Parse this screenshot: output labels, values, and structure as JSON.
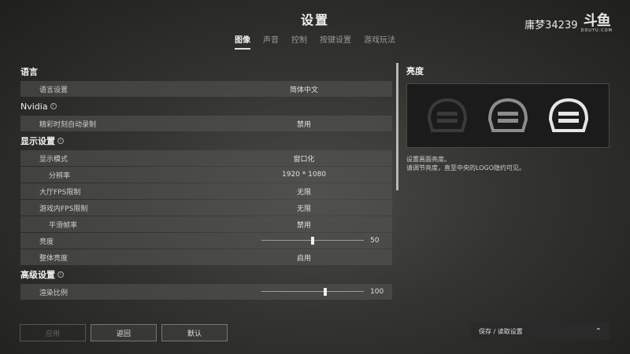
{
  "header": {
    "title": "设置",
    "tabs": [
      "图像",
      "声音",
      "控制",
      "按键设置",
      "游戏玩法"
    ],
    "active_tab": "图像"
  },
  "watermark": {
    "room": "庸梦34239",
    "logo": "斗鱼",
    "logo_sub": "DOUYU.COM"
  },
  "settings": {
    "sec_language": "语言",
    "language_label": "语言设置",
    "language_value": "简体中文",
    "sec_nvidia": "Nvidia",
    "highlights_label": "精彩时刻自动录制",
    "highlights_value": "禁用",
    "sec_display": "显示设置",
    "display_mode_label": "显示模式",
    "display_mode_value": "窗口化",
    "resolution_label": "分辨率",
    "resolution_value": "1920 * 1080",
    "lobby_fps_label": "大厅FPS限制",
    "lobby_fps_value": "无限",
    "ingame_fps_label": "游戏内FPS限制",
    "ingame_fps_value": "无限",
    "smooth_label": "平滑帧率",
    "smooth_value": "禁用",
    "brightness_label": "亮度",
    "brightness_value": "50",
    "brightness_fraction": 0.5,
    "overall_brightness_label": "整体亮度",
    "overall_brightness_value": "启用",
    "sec_advanced": "高级设置",
    "render_scale_label": "渲染比例",
    "render_scale_value": "100",
    "render_scale_fraction": 0.62
  },
  "preview": {
    "title": "亮度",
    "desc_line1": "设置画面亮度。",
    "desc_line2": "请调节亮度，直至中央的LOGO隐约可见。"
  },
  "buttons": {
    "apply": "应用",
    "back": "返回",
    "default": "默认"
  },
  "save_bar": {
    "label": "保存 / 读取设置"
  }
}
